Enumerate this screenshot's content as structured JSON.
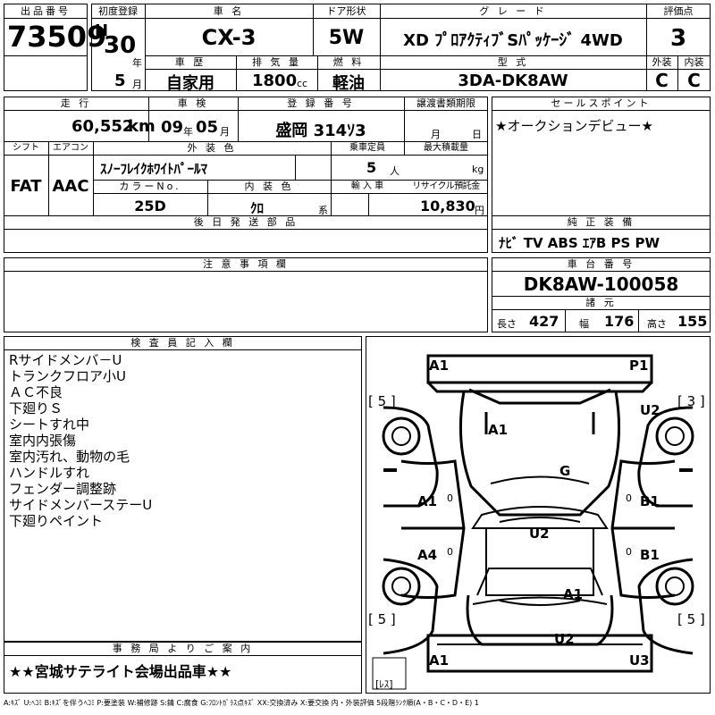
{
  "header": {
    "lot_label": "出品番号",
    "lot_number": "73509",
    "first_reg_label": "初度登録",
    "era": "H",
    "year": "30",
    "year_unit": "年",
    "month": "5",
    "month_unit": "月",
    "car_name_label": "車 名",
    "car_name": "CX-3",
    "door_label": "ドア形状",
    "door": "5W",
    "grade_label": "グ レ ー ド",
    "grade": "XD ﾌﾟﾛｱｸﾃｨﾌﾞSﾊﾟｯｹｰｼﾞ 4WD",
    "score_label": "評価点",
    "score": "3",
    "history_label": "車 歴",
    "history": "自家用",
    "displacement_label": "排 気 量",
    "displacement": "1800",
    "displacement_unit": "cc",
    "fuel_label": "燃 料",
    "fuel": "軽油",
    "model_label": "型 式",
    "model": "3DA-DK8AW",
    "exterior_label": "外装",
    "exterior": "C",
    "interior_label": "内装",
    "interior": "C"
  },
  "row2": {
    "mileage_label": "走 行",
    "mileage": "60,552",
    "mileage_unit": "km",
    "inspection_label": "車 検",
    "insp_year": "09",
    "insp_year_unit": "年",
    "insp_month": "05",
    "insp_month_unit": "月",
    "reg_label": "登 録 番 号",
    "reg": "盛岡 314ｿ3",
    "transfer_label": "譲渡書類期限",
    "transfer_month_unit": "月",
    "transfer_day_unit": "日",
    "shift_label": "シフト",
    "shift": "FAT",
    "ac_label": "エアコン",
    "ac": "AAC",
    "ext_color_label": "外 装 色",
    "ext_color": "ｽﾉｰﾌﾚｲｸﾎﾜｲﾄﾊﾟｰﾙﾏ",
    "capacity_label": "乗車定員",
    "capacity": "5",
    "capacity_unit": "人",
    "load_label": "最大積載量",
    "load_unit": "kg",
    "color_no_label": "カラーNo.",
    "color_no": "25D",
    "int_color_label": "内 装 色",
    "int_color": "ｸﾛ",
    "int_color_unit": "系",
    "import_label": "輸 入 車",
    "recycle_label": "リサイクル預託金",
    "recycle": "10,830",
    "recycle_unit": "円"
  },
  "sales": {
    "label": "セールスポイント",
    "text": "★オークションデビュー★"
  },
  "later_parts": {
    "label": "後 日 発 送 部 品"
  },
  "equipment": {
    "label": "純 正 装 備",
    "text": "ﾅﾋﾞ  TV  ABS ｴｱB PS PW"
  },
  "notes": {
    "label": "注 意 事 項 欄"
  },
  "chassis": {
    "label": "車 台 番 号",
    "number": "DK8AW-100058",
    "spec_label": "諸 元",
    "length_label": "長さ",
    "length": "427",
    "width_label": "幅",
    "width": "176",
    "height_label": "高さ",
    "height": "155"
  },
  "inspector": {
    "label": "検 査 員 記 入 欄",
    "lines": [
      "Rサイドメンバ－U",
      "トランクフロア小U",
      "ＡＣ不良",
      "下廻りＳ",
      "シートすれ中",
      "室内内張傷",
      "室内汚れ、動物の毛",
      "ハンドルすれ",
      "フェンダー調整跡",
      "サイドメンバーステーU",
      "下廻りペイント"
    ]
  },
  "office": {
    "label": "事 務 局 よ り ご 案 内",
    "text": "★★宮城サテライト会場出品車★★"
  },
  "diagram": {
    "marks": [
      "A1",
      "P1",
      "A1",
      "U2",
      "G",
      "A1",
      "B1",
      "U2",
      "A4",
      "B1",
      "A1",
      "U2",
      "A1",
      "U3"
    ],
    "tires": [
      "[ 5 ]",
      "[ 3 ]",
      "[ 5 ]",
      "[ 5 ]",
      "[ﾚｽ]"
    ],
    "zeros": [
      "0",
      "0",
      "0",
      "0"
    ]
  },
  "legend": "A:ｷｽﾞ U:ﾍｺﾐ B:ｷｽﾞを伴うﾍｺﾐ P:要塗装 W:補修跡 S:錆 C:腐食 G:ﾌﾛﾝﾄｶﾞﾗｽ点ｷｽﾞ XX:交換済み X:要交換  内・外装評価  5段階ﾗﾝｸ順(A・B・C・D・E) 1"
}
